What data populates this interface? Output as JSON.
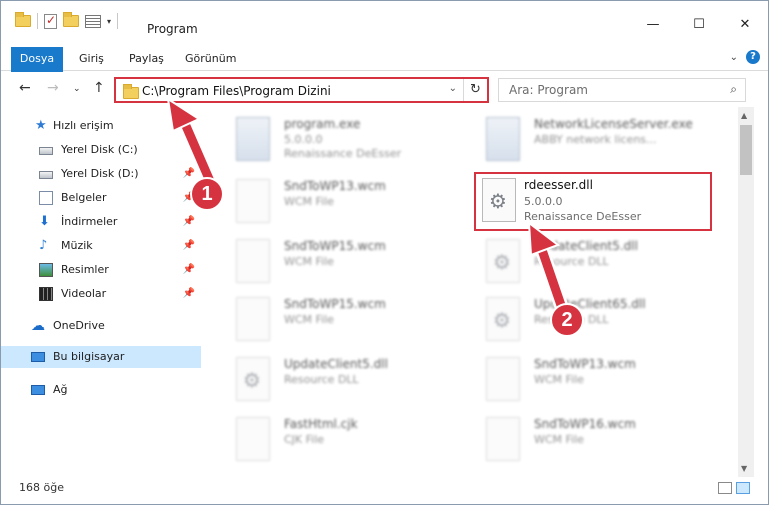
{
  "window": {
    "title": "Program",
    "controls": {
      "minimize": "—",
      "maximize": "☐",
      "close": "✕"
    }
  },
  "ribbon": {
    "tabs": [
      "Dosya",
      "Giriş",
      "Paylaş",
      "Görünüm"
    ],
    "help": "?"
  },
  "nav": {
    "address": "C:\\Program Files\\Program Dizini",
    "search_placeholder": "Ara: Program"
  },
  "sidebar": {
    "items": [
      {
        "label": "Hızlı erişim"
      },
      {
        "label": "Yerel Disk (C:)"
      },
      {
        "label": "Yerel Disk (D:)"
      },
      {
        "label": "Belgeler"
      },
      {
        "label": "İndirmeler"
      },
      {
        "label": "Müzik"
      },
      {
        "label": "Resimler"
      },
      {
        "label": "Videolar"
      },
      {
        "label": "OneDrive"
      },
      {
        "label": "Bu bilgisayar"
      },
      {
        "label": "Ağ"
      }
    ]
  },
  "files": [
    {
      "name": "program.exe",
      "line1": "5.0.0.0",
      "line2": "Renaissance DeEsser"
    },
    {
      "name": "NetworkLicenseServer.exe",
      "line1": "ABBY network licens...",
      "line2": ""
    },
    {
      "name": "SndToWP13.wcm",
      "line1": "WCM File",
      "line2": ""
    },
    {
      "name": "SndToWP15.wcm",
      "line1": "WCM File",
      "line2": ""
    },
    {
      "name": "UpdateClient5.dll",
      "line1": "Resource DLL",
      "line2": ""
    },
    {
      "name": "SndToWP15.wcm",
      "line1": "WCM File",
      "line2": ""
    },
    {
      "name": "UpdateClient65.dll",
      "line1": "Resource DLL",
      "line2": ""
    },
    {
      "name": "UpdateClient5.dll",
      "line1": "Resource DLL",
      "line2": ""
    },
    {
      "name": "SndToWP13.wcm",
      "line1": "WCM File",
      "line2": ""
    },
    {
      "name": "FastHtml.cjk",
      "line1": "CJK File",
      "line2": ""
    },
    {
      "name": "SndToWP16.wcm",
      "line1": "WCM File",
      "line2": ""
    }
  ],
  "highlighted_file": {
    "name": "rdeesser.dll",
    "version": "5.0.0.0",
    "company": "Renaissance DeEsser"
  },
  "status": {
    "count": "168 öğe"
  },
  "callouts": {
    "one": "1",
    "two": "2"
  },
  "colors": {
    "accent": "#1979ca",
    "highlight": "#d63340",
    "selection": "#cce8ff"
  }
}
